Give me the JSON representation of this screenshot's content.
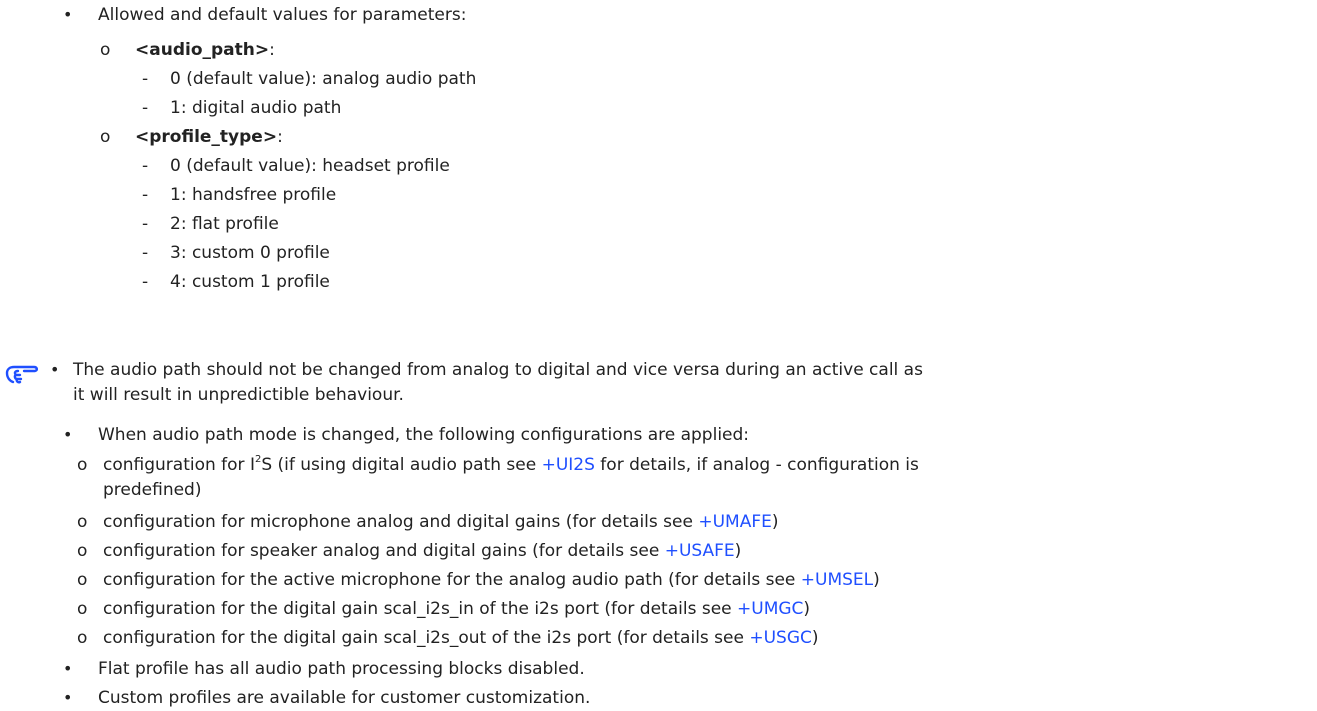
{
  "markers": {
    "bullet": "•",
    "sub_bullet": "o",
    "dash": "-"
  },
  "colors": {
    "text": "#222222",
    "link": "#1f4fff",
    "note_icon": "#1f4fff"
  },
  "params": {
    "intro": "Allowed and default values for parameters:",
    "audio_path": {
      "name": "<audio_path>",
      "suffix": ":",
      "values": [
        "0 (default value): analog audio path",
        "1: digital audio path"
      ]
    },
    "profile_type": {
      "name": "<profile_type>",
      "suffix": ":",
      "values": [
        "0 (default value): headset profile",
        "1: handsfree profile",
        "2: flat profile",
        "3: custom 0 profile",
        "4: custom 1 profile"
      ]
    }
  },
  "notes": {
    "icon": "pointing-hand-icon",
    "warning_line1": "The audio path should not be changed from analog to digital and vice versa during an active call as",
    "warning_line2": "it will result in unpredictible behaviour.",
    "change_intro": "When audio path mode is changed, the following configurations are applied:",
    "i2s": {
      "pre": "configuration for I",
      "sup": "2",
      "mid": "S (if using digital audio path see ",
      "link": "+UI2S",
      "post": " for details, if analog - configuration is",
      "line2": "predefined)"
    },
    "config_items": [
      {
        "text": "configuration for microphone analog and digital gains (for details see ",
        "link": "+UMAFE",
        "end": ")"
      },
      {
        "text": "configuration for speaker analog and digital gains (for details see ",
        "link": "+USAFE",
        "end": ")"
      },
      {
        "text": "configuration for the active microphone for the analog audio path (for details see ",
        "link": "+UMSEL",
        "end": ")"
      },
      {
        "text": "configuration for the digital gain scal_i2s_in of the i2s port (for details see ",
        "link": "+UMGC",
        "end": ")"
      },
      {
        "text": "configuration for the digital gain scal_i2s_out of the i2s port (for details see ",
        "link": "+USGC",
        "end": ")"
      }
    ],
    "flat_profile": "Flat profile has all audio path processing blocks disabled.",
    "custom_profiles": "Custom profiles are available for customer customization."
  }
}
